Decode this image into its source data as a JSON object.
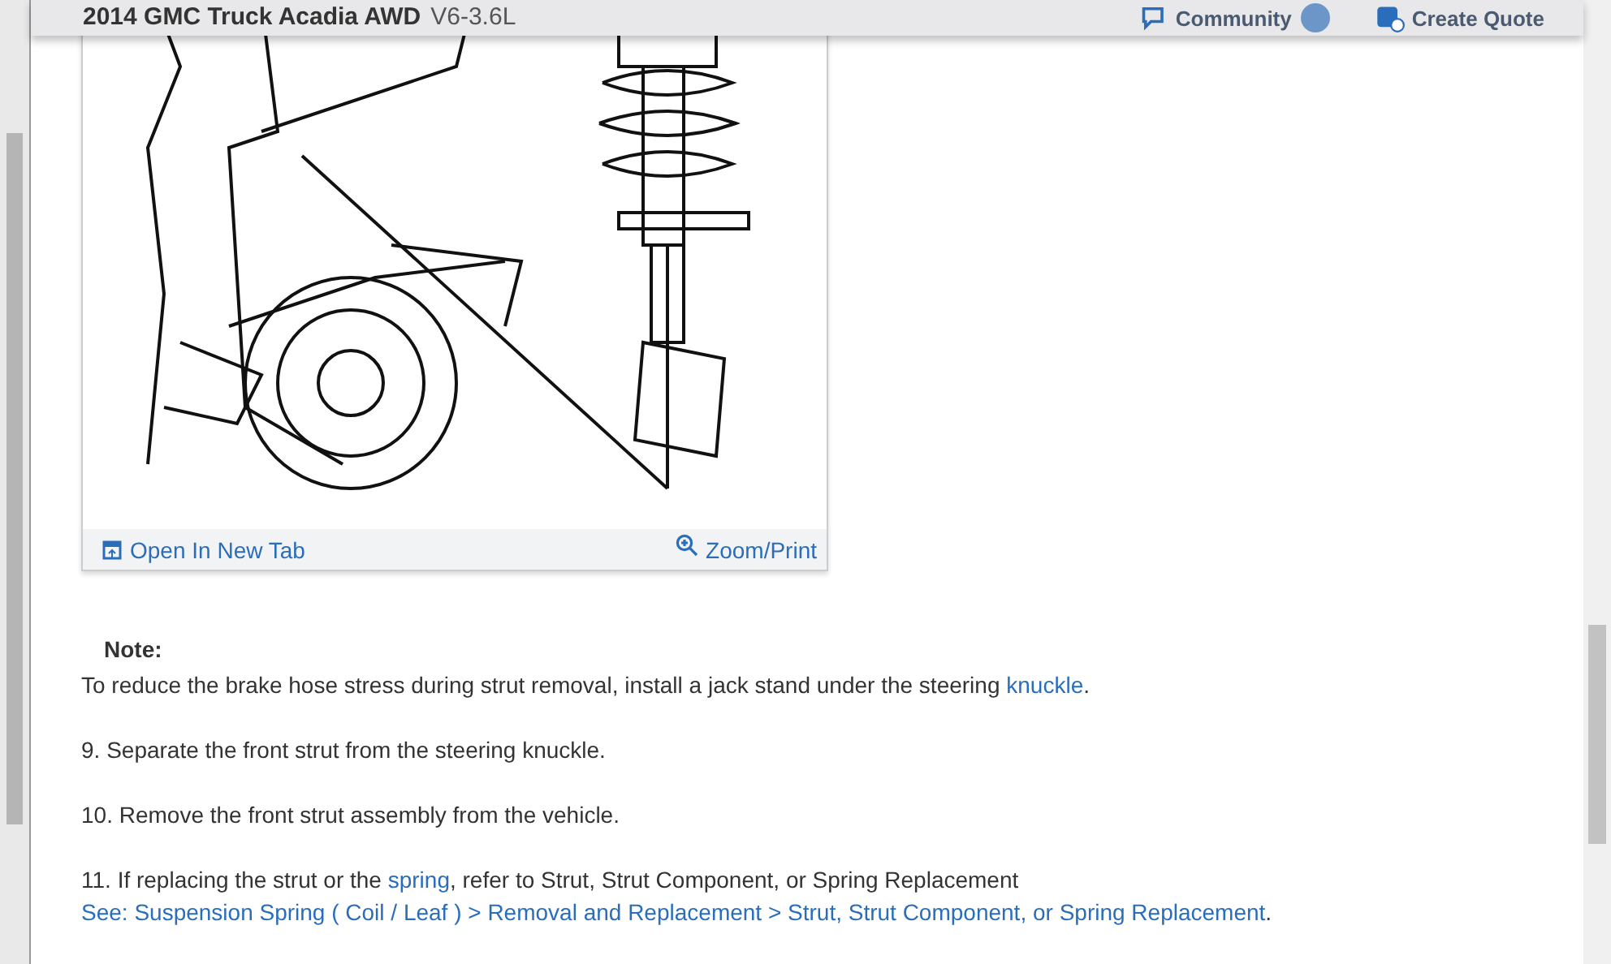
{
  "header": {
    "title": "2014 GMC Truck Acadia AWD",
    "subtitle": "V6-3.6L",
    "community": "Community",
    "create_quote": "Create Quote"
  },
  "figure": {
    "open_link": "Open In New Tab",
    "zoom_link": "Zoom/Print"
  },
  "note": {
    "label": "Note:",
    "segments": [
      {
        "text": "To reduce the brake hose stress during strut removal, install a jack stand under the steering ",
        "link": false
      },
      {
        "text": "knuckle",
        "link": true
      },
      {
        "text": ".",
        "link": false
      }
    ]
  },
  "steps": [
    {
      "segments": [
        {
          "text": " 9. Separate the front strut from the steering knuckle.",
          "link": false
        }
      ]
    },
    {
      "segments": [
        {
          "text": "10. Remove the front strut assembly from the vehicle.",
          "link": false
        }
      ]
    },
    {
      "segments": [
        {
          "text": "11. If replacing the strut or the ",
          "link": false
        },
        {
          "text": "spring",
          "link": true
        },
        {
          "text": ", refer to Strut, Strut Component, or Spring Replacement ",
          "link": false
        },
        {
          "text": "See: Suspension Spring ( Coil / Leaf ) > Removal ",
          "link": true
        },
        {
          "text": "and Replacement > Strut, Strut Component, or Spring Replacement",
          "link": true
        },
        {
          "text": ".",
          "link": false
        }
      ]
    }
  ]
}
